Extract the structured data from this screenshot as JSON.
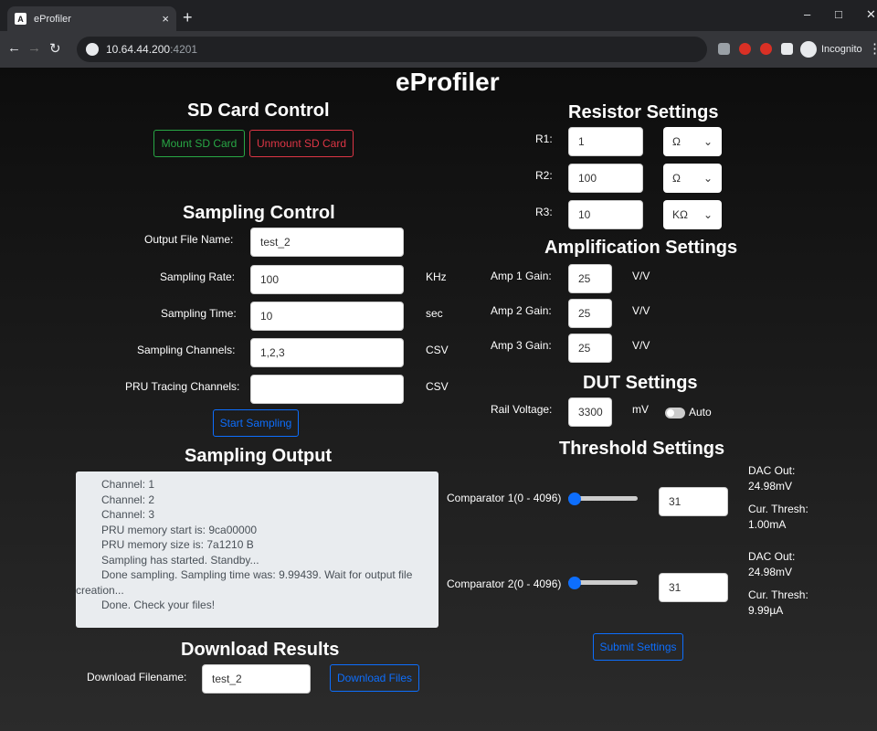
{
  "browser": {
    "tab_title": "eProfiler",
    "url_host": "10.64.44.200",
    "url_port": ":4201",
    "incognito_label": "Incognito"
  },
  "page_title": "eProfiler",
  "sd_card": {
    "title": "SD Card Control",
    "mount_label": "Mount SD Card",
    "unmount_label": "Unmount SD Card"
  },
  "sampling": {
    "title": "Sampling Control",
    "fields": [
      {
        "label": "Output File Name:",
        "value": "test_2",
        "unit": ""
      },
      {
        "label": "Sampling Rate:",
        "value": "100",
        "unit": "KHz"
      },
      {
        "label": "Sampling Time:",
        "value": "10",
        "unit": "sec"
      },
      {
        "label": "Sampling Channels:",
        "value": "1,2,3",
        "unit": "CSV"
      },
      {
        "label": "PRU Tracing Channels:",
        "value": "",
        "unit": "CSV"
      }
    ],
    "start_label": "Start Sampling"
  },
  "output": {
    "title": "Sampling Output",
    "lines": [
      "Channel: 1",
      "Channel: 2",
      "Channel: 3",
      "PRU memory start is: 9ca00000",
      "PRU memory size is: 7a1210 B",
      "Sampling has started. Standby...",
      "Done sampling. Sampling time was: 9.99439. Wait for output file creation...",
      "Done. Check your files!"
    ]
  },
  "download": {
    "title": "Download Results",
    "filename_label": "Download Filename:",
    "filename_value": "test_2",
    "button_label": "Download Files"
  },
  "resistor": {
    "title": "Resistor Settings",
    "rows": [
      {
        "label": "R1:",
        "value": "1",
        "unit": "Ω"
      },
      {
        "label": "R2:",
        "value": "100",
        "unit": "Ω"
      },
      {
        "label": "R3:",
        "value": "10",
        "unit": "KΩ"
      }
    ]
  },
  "amplification": {
    "title": "Amplification Settings",
    "rows": [
      {
        "label": "Amp 1 Gain:",
        "value": "25",
        "unit": "V/V"
      },
      {
        "label": "Amp 2 Gain:",
        "value": "25",
        "unit": "V/V"
      },
      {
        "label": "Amp 3 Gain:",
        "value": "25",
        "unit": "V/V"
      }
    ]
  },
  "dut": {
    "title": "DUT Settings",
    "rail_label": "Rail Voltage:",
    "rail_value": "3300",
    "rail_unit": "mV",
    "auto_label": "Auto",
    "auto_on": false
  },
  "threshold": {
    "title": "Threshold Settings",
    "comparators": [
      {
        "label": "Comparator 1(0 - 4096)",
        "value": "31",
        "slider_fraction": 0.0076,
        "dac_label": "DAC Out:",
        "dac_value": "24.98mV",
        "thresh_label": "Cur. Thresh:",
        "thresh_value": "1.00mA"
      },
      {
        "label": "Comparator 2(0 - 4096)",
        "value": "31",
        "slider_fraction": 0.0076,
        "dac_label": "DAC Out:",
        "dac_value": "24.98mV",
        "thresh_label": "Cur. Thresh:",
        "thresh_value": "9.99µA"
      }
    ],
    "submit_label": "Submit Settings"
  },
  "colors": {
    "green": "#28a745",
    "red": "#dc3545",
    "blue": "#0d6efd"
  }
}
